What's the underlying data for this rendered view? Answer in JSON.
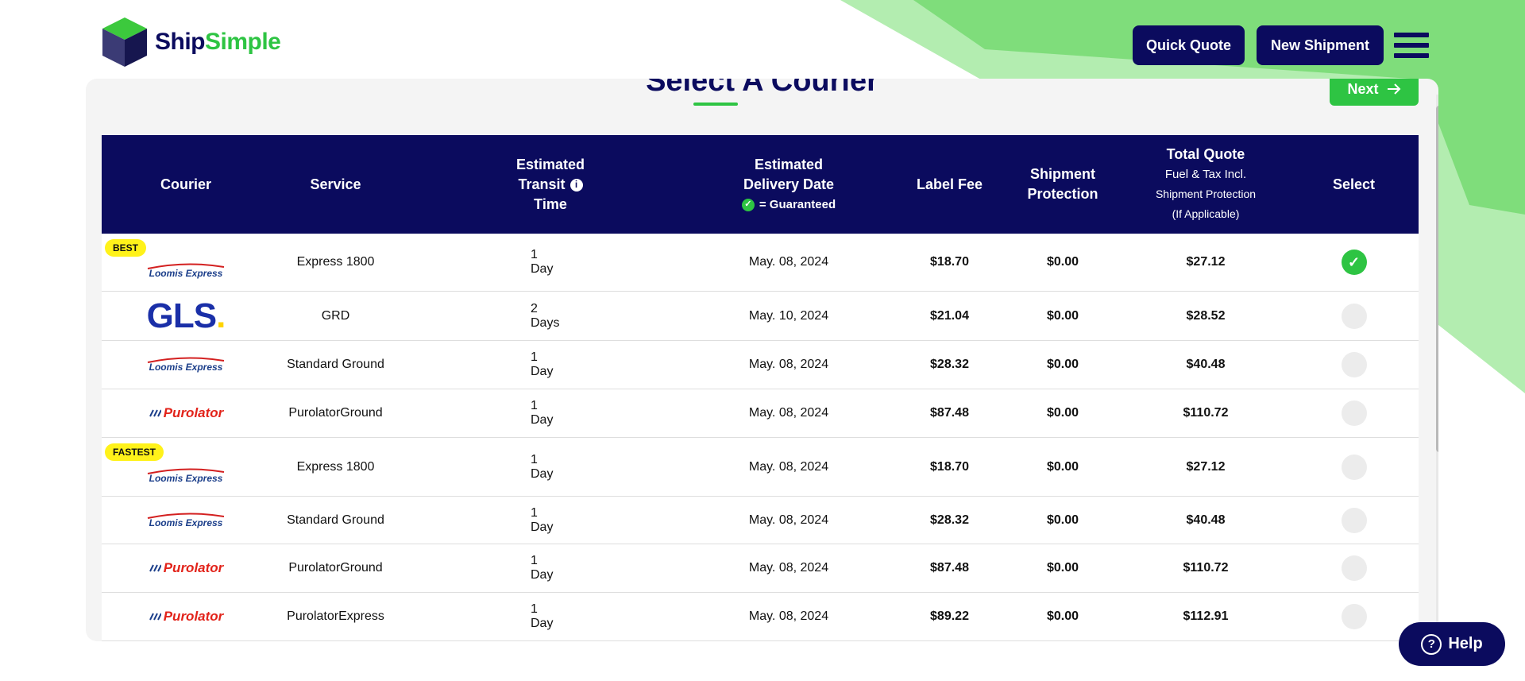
{
  "brand": {
    "name_part1": "Ship",
    "name_part2": "Simple"
  },
  "header": {
    "quick_quote": "Quick Quote",
    "new_shipment": "New Shipment"
  },
  "page": {
    "title": "Select A Courier",
    "next_label": "Next"
  },
  "table": {
    "headers": {
      "courier": "Courier",
      "service": "Service",
      "transit_1": "Estimated",
      "transit_2": "Transit",
      "transit_3": "Time",
      "delivery_1": "Estimated",
      "delivery_2": "Delivery Date",
      "delivery_note": "= Guaranteed",
      "label_fee": "Label Fee",
      "protection_1": "Shipment",
      "protection_2": "Protection",
      "total_1": "Total Quote",
      "total_2": "Fuel & Tax Incl.",
      "total_3": "Shipment Protection",
      "total_4": "(If Applicable)",
      "select": "Select"
    },
    "rows": [
      {
        "tag": "BEST",
        "courier": "Loomis Express",
        "service": "Express 1800",
        "transit": "1 Day",
        "date": "May. 08, 2024",
        "label_fee": "$18.70",
        "protection": "$0.00",
        "total": "$27.12",
        "selected": true
      },
      {
        "tag": "",
        "courier": "GLS",
        "service": "GRD",
        "transit": "2 Days",
        "date": "May. 10, 2024",
        "label_fee": "$21.04",
        "protection": "$0.00",
        "total": "$28.52",
        "selected": false
      },
      {
        "tag": "",
        "courier": "Loomis Express",
        "service": "Standard Ground",
        "transit": "1 Day",
        "date": "May. 08, 2024",
        "label_fee": "$28.32",
        "protection": "$0.00",
        "total": "$40.48",
        "selected": false
      },
      {
        "tag": "",
        "courier": "Purolator",
        "service": "PurolatorGround",
        "transit": "1 Day",
        "date": "May. 08, 2024",
        "label_fee": "$87.48",
        "protection": "$0.00",
        "total": "$110.72",
        "selected": false
      },
      {
        "tag": "FASTEST",
        "courier": "Loomis Express",
        "service": "Express 1800",
        "transit": "1 Day",
        "date": "May. 08, 2024",
        "label_fee": "$18.70",
        "protection": "$0.00",
        "total": "$27.12",
        "selected": false
      },
      {
        "tag": "",
        "courier": "Loomis Express",
        "service": "Standard Ground",
        "transit": "1 Day",
        "date": "May. 08, 2024",
        "label_fee": "$28.32",
        "protection": "$0.00",
        "total": "$40.48",
        "selected": false
      },
      {
        "tag": "",
        "courier": "Purolator",
        "service": "PurolatorGround",
        "transit": "1 Day",
        "date": "May. 08, 2024",
        "label_fee": "$87.48",
        "protection": "$0.00",
        "total": "$110.72",
        "selected": false
      },
      {
        "tag": "",
        "courier": "Purolator",
        "service": "PurolatorExpress",
        "transit": "1 Day",
        "date": "May. 08, 2024",
        "label_fee": "$89.22",
        "protection": "$0.00",
        "total": "$112.91",
        "selected": false
      }
    ]
  },
  "help": {
    "label": "Help"
  },
  "colors": {
    "navy": "#0b0b5e",
    "green": "#2ec443",
    "tag_yellow": "#fff21a"
  },
  "icons": [
    "info-icon",
    "check-icon",
    "arrow-right-icon",
    "menu-icon",
    "help-icon"
  ]
}
